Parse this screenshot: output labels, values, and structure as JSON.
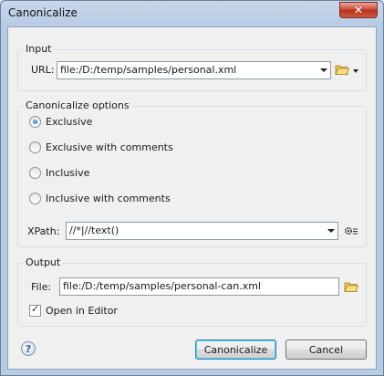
{
  "window": {
    "title": "Canonicalize",
    "close_glyph": "✕"
  },
  "input": {
    "group_label": "Input",
    "url_label": "URL:",
    "url_value": "file:/D:/temp/samples/personal.xml",
    "open_icon": "folder-open-icon"
  },
  "options": {
    "group_label": "Canonicalize options",
    "radios": [
      {
        "label": "Exclusive",
        "checked": true
      },
      {
        "label": "Exclusive with comments",
        "checked": false
      },
      {
        "label": "Inclusive",
        "checked": false
      },
      {
        "label": "Inclusive with comments",
        "checked": false
      }
    ],
    "xpath_label": "XPath:",
    "xpath_value": "//*|//text()",
    "settings_icon": "gear-icon"
  },
  "output": {
    "group_label": "Output",
    "file_label": "File:",
    "file_value": "file:/D:/temp/samples/personal-can.xml",
    "open_in_editor_label": "Open in Editor",
    "open_in_editor_checked": true
  },
  "buttons": {
    "help_glyph": "?",
    "ok": "Canonicalize",
    "cancel": "Cancel"
  },
  "colors": {
    "accent": "#3c7fb1",
    "title_bar": "#c9d7ea",
    "close": "#c7442f"
  }
}
